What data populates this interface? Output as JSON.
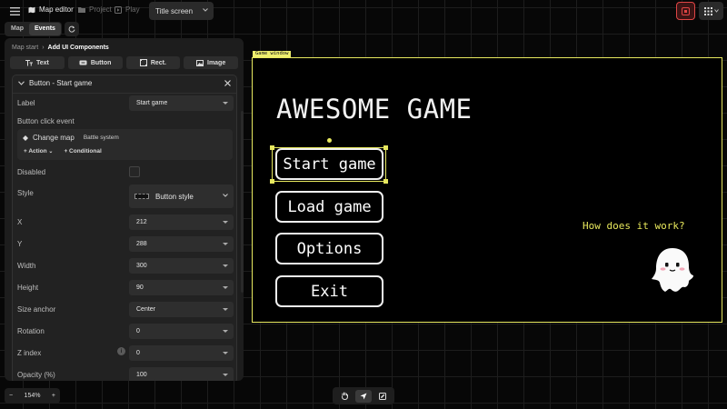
{
  "topbar": {
    "breadcrumbs": [
      {
        "label": "Map editor",
        "icon": "map-icon",
        "active": true
      },
      {
        "label": "Project",
        "icon": "folder-icon",
        "active": false
      },
      {
        "label": "Play",
        "icon": "play-icon",
        "active": false
      }
    ],
    "scene_select": "Title screen"
  },
  "tabs": [
    "Map",
    "Events"
  ],
  "panel": {
    "breadcrumb": {
      "parent": "Map start",
      "current": "Add UI Components"
    },
    "components": [
      {
        "label": "Text",
        "icon": "text-icon"
      },
      {
        "label": "Button",
        "icon": "button-icon"
      },
      {
        "label": "Rect.",
        "icon": "rect-icon"
      },
      {
        "label": "Image",
        "icon": "image-icon"
      }
    ],
    "inspector": {
      "title": "Button - Start game",
      "label_label": "Label",
      "label_value": "Start game",
      "click_event_label": "Button click event",
      "event_action": "Change map",
      "event_target": "Battle system",
      "add_action": "+ Action",
      "add_conditional": "+ Conditional",
      "disabled_label": "Disabled",
      "style_label": "Style",
      "style_value": "Button style",
      "fields": [
        {
          "label": "X",
          "value": "212"
        },
        {
          "label": "Y",
          "value": "288"
        },
        {
          "label": "Width",
          "value": "300"
        },
        {
          "label": "Height",
          "value": "90"
        },
        {
          "label": "Size anchor",
          "value": "Center"
        },
        {
          "label": "Rotation",
          "value": "0"
        },
        {
          "label": "Z index",
          "value": "0"
        },
        {
          "label": "Opacity (%)",
          "value": "100"
        }
      ]
    }
  },
  "zoom": {
    "minus": "−",
    "value": "154%",
    "plus": "+"
  },
  "game": {
    "window_tag": "Game window",
    "title": "AWESOME GAME",
    "buttons": [
      "Start game",
      "Load game",
      "Options",
      "Exit"
    ],
    "help": "How does it work?"
  },
  "colors": {
    "accent": "#e7e85f",
    "record": "#e04545"
  }
}
